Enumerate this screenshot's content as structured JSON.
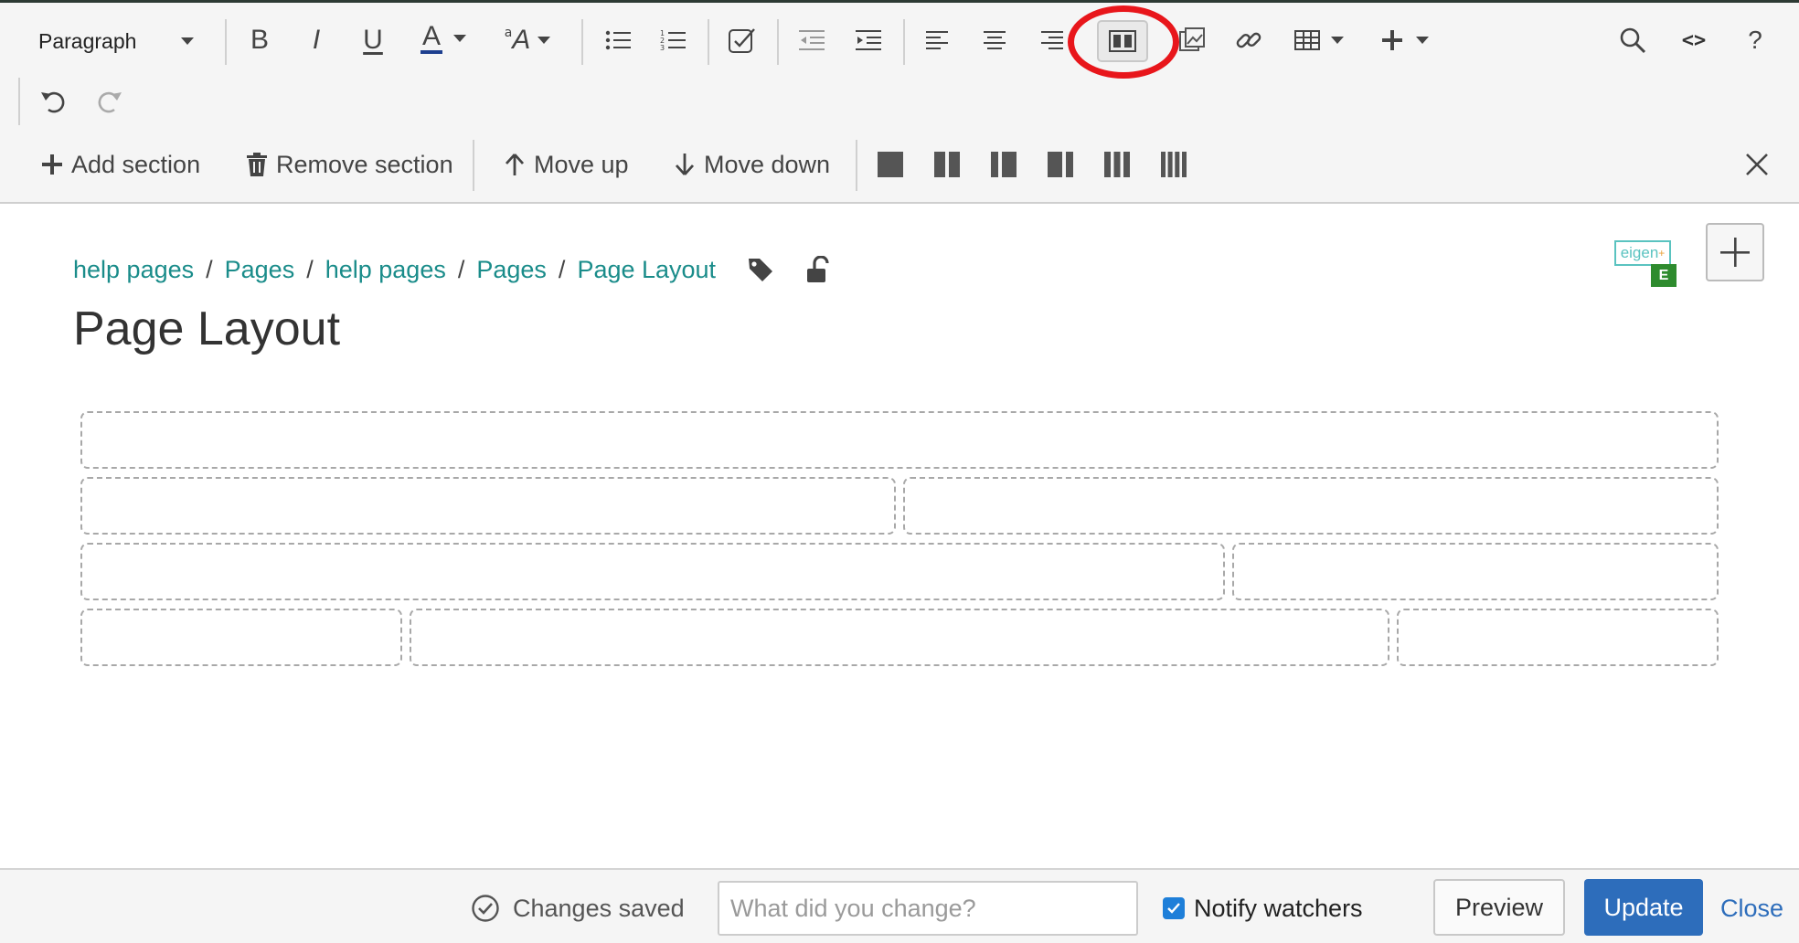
{
  "toolbar": {
    "paragraph_select": "Paragraph",
    "bold": "B",
    "italic": "I",
    "underline": "U",
    "text_color": "A",
    "font_size": "A",
    "font_size_prefix": "a",
    "code_view": "<>",
    "help": "?",
    "highlight_color": "#e8161b",
    "icons": [
      "bold-icon",
      "italic-icon",
      "underline-icon",
      "text-color-icon",
      "font-size-icon",
      "bullet-list-icon",
      "numbered-list-icon",
      "task-list-icon",
      "outdent-icon",
      "indent-icon",
      "align-left-icon",
      "align-center-icon",
      "align-right-icon",
      "layout-icon",
      "image-icon",
      "link-icon",
      "table-icon",
      "insert-icon",
      "search-icon",
      "undo-icon",
      "redo-icon"
    ]
  },
  "section_toolbar": {
    "add_section": "Add section",
    "remove_section": "Remove section",
    "move_up": "Move up",
    "move_down": "Move down",
    "layouts": [
      "one-column",
      "two-columns",
      "left-sidebar",
      "right-sidebar",
      "three-columns",
      "four-columns"
    ]
  },
  "breadcrumb": [
    "help pages",
    "Pages",
    "help pages",
    "Pages",
    "Page Layout"
  ],
  "page_title": "Page Layout",
  "badge": {
    "eigen_text": "eigen",
    "eigen_sup": "+",
    "e_label": "E"
  },
  "footer": {
    "status": "Changes saved",
    "change_placeholder": "What did you change?",
    "notify_label": "Notify watchers",
    "notify_checked": true,
    "preview": "Preview",
    "update": "Update",
    "close": "Close"
  },
  "colors": {
    "link": "#1a8c8a",
    "primary": "#2d6dbb",
    "checkbox": "#1e7fd9",
    "badge_green": "#2e8b2e",
    "badge_teal": "#5ac3c0"
  }
}
